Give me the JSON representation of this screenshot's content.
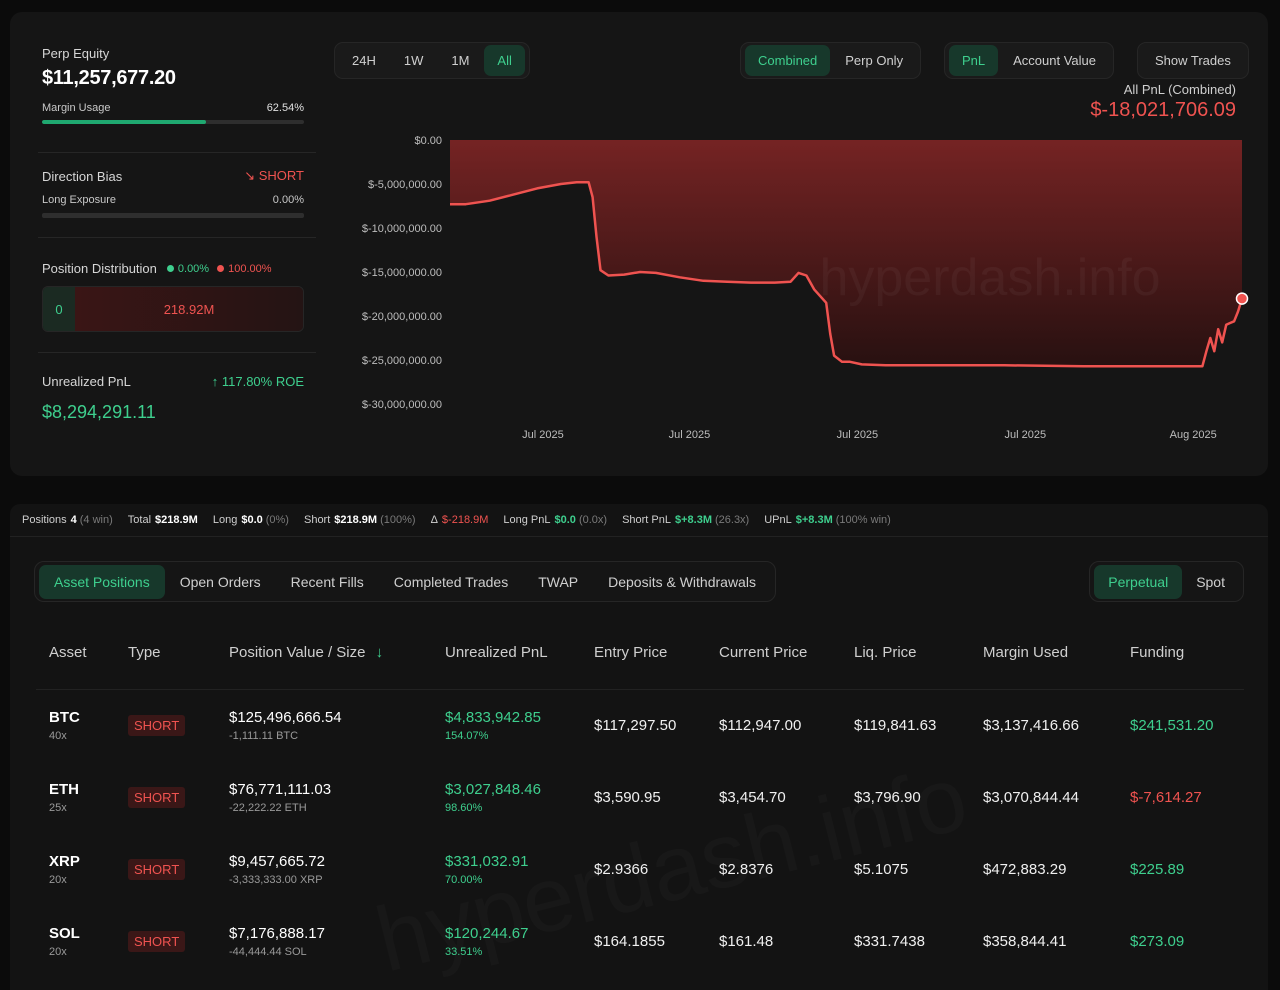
{
  "summary": {
    "perp_equity_label": "Perp Equity",
    "perp_equity_value": "$11,257,677.20",
    "margin_usage_label": "Margin Usage",
    "margin_usage_value": "62.54%",
    "margin_usage_fraction": 0.6254,
    "direction_bias_label": "Direction Bias",
    "direction_bias_value": "SHORT",
    "long_exposure_label": "Long Exposure",
    "long_exposure_value": "0.00%",
    "position_distribution_label": "Position Distribution",
    "distribution_long_pct": "0.00%",
    "distribution_short_pct": "100.00%",
    "distribution_long_amount": "0",
    "distribution_short_amount": "218.92M",
    "unrealized_pnl_label": "Unrealized PnL",
    "roe_value": "117.80% ROE",
    "unrealized_pnl_value": "$8,294,291.11"
  },
  "controls": {
    "timeframes": [
      "24H",
      "1W",
      "1M",
      "All"
    ],
    "timeframe_active": "All",
    "mode_combined": "Combined",
    "mode_perp_only": "Perp Only",
    "metric_pnl": "PnL",
    "metric_account_value": "Account Value",
    "show_trades": "Show Trades"
  },
  "chart_header": {
    "label": "All PnL (Combined)",
    "value": "$-18,021,706.09"
  },
  "watermark": "hyperdash.info",
  "colors": {
    "green": "#3ecf8e",
    "red": "#ef5350",
    "background": "#0b0b0b"
  },
  "chart_data": {
    "type": "area",
    "y_ticks": [
      "$0.00",
      "$-5,000,000.00",
      "$-10,000,000.00",
      "$-15,000,000.00",
      "$-20,000,000.00",
      "$-25,000,000.00",
      "$-30,000,000.00"
    ],
    "ylim": [
      -30000000,
      0
    ],
    "x_ticks": [
      "Jul 2025",
      "Jul 2025",
      "Jul 2025",
      "Jul 2025",
      "Aug 2025"
    ],
    "x_tick_positions": [
      0.13,
      0.315,
      0.527,
      0.739,
      0.951
    ],
    "series": [
      {
        "x": [
          0,
          0.02,
          0.05,
          0.08,
          0.11,
          0.14,
          0.16,
          0.175,
          0.18,
          0.185,
          0.19,
          0.2,
          0.22,
          0.24,
          0.26,
          0.29,
          0.32,
          0.35,
          0.38,
          0.41,
          0.43,
          0.44,
          0.45,
          0.46,
          0.475,
          0.48,
          0.485,
          0.495,
          0.505,
          0.52,
          0.55,
          0.6,
          0.7,
          0.8,
          0.9,
          0.95,
          0.955,
          0.96,
          0.965,
          0.97,
          0.975,
          0.98,
          0.985,
          0.99,
          0.995,
          1.0
        ],
        "y": [
          -7300000,
          -7300000,
          -6900000,
          -6200000,
          -5500000,
          -5000000,
          -4800000,
          -4800000,
          -6500000,
          -11000000,
          -14800000,
          -15400000,
          -15300000,
          -15000000,
          -15100000,
          -15600000,
          -16000000,
          -16100000,
          -16200000,
          -16200000,
          -16100000,
          -15100000,
          -15400000,
          -17000000,
          -18500000,
          -22000000,
          -24500000,
          -25200000,
          -25200000,
          -25500000,
          -25600000,
          -25600000,
          -25600000,
          -25700000,
          -25700000,
          -25700000,
          -24000000,
          -22500000,
          -24000000,
          -21500000,
          -23000000,
          -21000000,
          -20800000,
          -20600000,
          -19500000,
          -18021706
        ]
      }
    ]
  },
  "stats_bar": {
    "positions_label": "Positions",
    "positions_value": "4",
    "positions_note": "(4 win)",
    "total_label": "Total",
    "total_value": "$218.9M",
    "long_label": "Long",
    "long_value": "$0.0",
    "long_note": "(0%)",
    "short_label": "Short",
    "short_value": "$218.9M",
    "short_note": "(100%)",
    "delta_label": "Δ",
    "delta_value": "$-218.9M",
    "long_pnl_label": "Long PnL",
    "long_pnl_value": "$0.0",
    "long_pnl_note": "(0.0x)",
    "short_pnl_label": "Short PnL",
    "short_pnl_value": "$+8.3M",
    "short_pnl_note": "(26.3x)",
    "upnl_label": "UPnL",
    "upnl_value": "$+8.3M",
    "upnl_note": "(100% win)"
  },
  "tabs": [
    "Asset Positions",
    "Open Orders",
    "Recent Fills",
    "Completed Trades",
    "TWAP",
    "Deposits & Withdrawals"
  ],
  "tab_active": "Asset Positions",
  "market_tabs": [
    "Perpetual",
    "Spot"
  ],
  "market_active": "Perpetual",
  "table": {
    "headers": [
      "Asset",
      "Type",
      "Position Value / Size",
      "Unrealized PnL",
      "Entry Price",
      "Current Price",
      "Liq. Price",
      "Margin Used",
      "Funding"
    ],
    "rows": [
      {
        "asset": "BTC",
        "leverage": "40x",
        "type": "SHORT",
        "value": "$125,496,666.54",
        "size": "-1,111.11 BTC",
        "upnl": "$4,833,942.85",
        "upnl_pct": "154.07%",
        "entry": "$117,297.50",
        "current": "$112,947.00",
        "liq": "$119,841.63",
        "margin": "$3,137,416.66",
        "funding": "$241,531.20",
        "funding_positive": true
      },
      {
        "asset": "ETH",
        "leverage": "25x",
        "type": "SHORT",
        "value": "$76,771,111.03",
        "size": "-22,222.22 ETH",
        "upnl": "$3,027,848.46",
        "upnl_pct": "98.60%",
        "entry": "$3,590.95",
        "current": "$3,454.70",
        "liq": "$3,796.90",
        "margin": "$3,070,844.44",
        "funding": "$-7,614.27",
        "funding_positive": false
      },
      {
        "asset": "XRP",
        "leverage": "20x",
        "type": "SHORT",
        "value": "$9,457,665.72",
        "size": "-3,333,333.00 XRP",
        "upnl": "$331,032.91",
        "upnl_pct": "70.00%",
        "entry": "$2.9366",
        "current": "$2.8376",
        "liq": "$5.1075",
        "margin": "$472,883.29",
        "funding": "$225.89",
        "funding_positive": true
      },
      {
        "asset": "SOL",
        "leverage": "20x",
        "type": "SHORT",
        "value": "$7,176,888.17",
        "size": "-44,444.44 SOL",
        "upnl": "$120,244.67",
        "upnl_pct": "33.51%",
        "entry": "$164.1855",
        "current": "$161.48",
        "liq": "$331.7438",
        "margin": "$358,844.41",
        "funding": "$273.09",
        "funding_positive": true
      }
    ]
  }
}
